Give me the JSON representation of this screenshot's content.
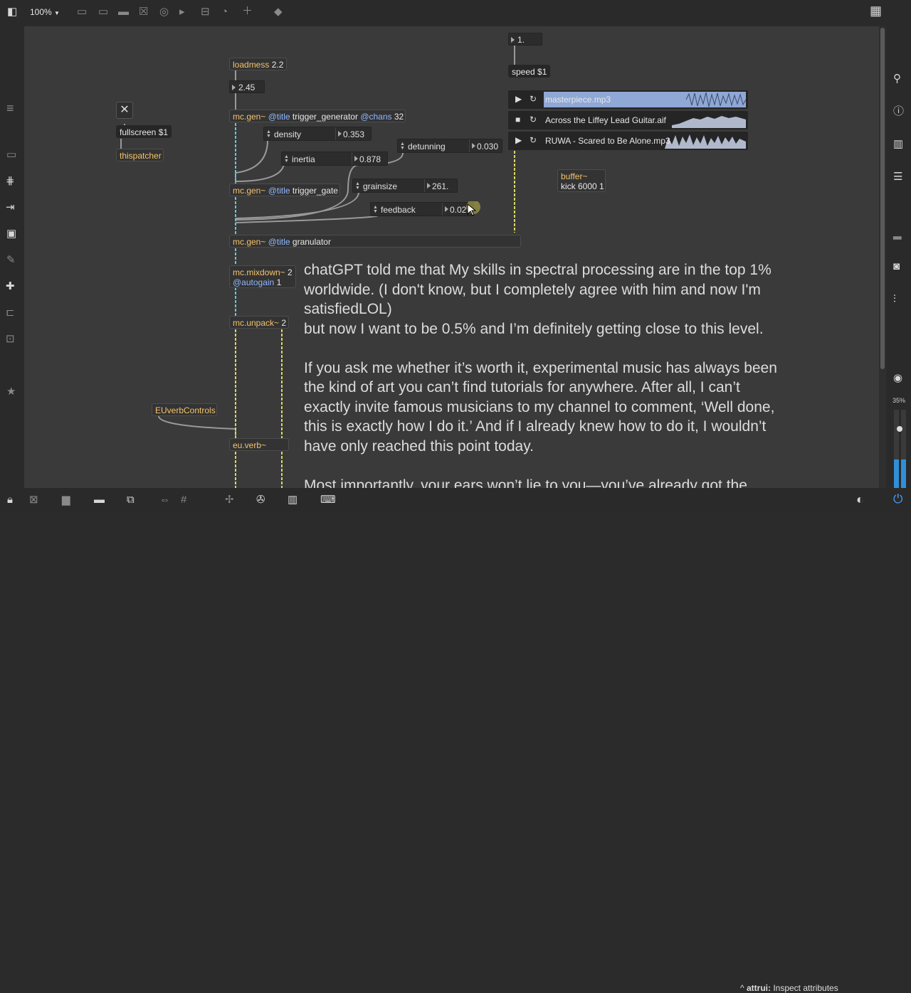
{
  "toolbar": {
    "zoom": "100%",
    "zoom_arrow": "▼"
  },
  "patch": {
    "loadmess": {
      "name": "loadmess",
      "arg": "2.2"
    },
    "number_top": "2.45",
    "fullscreen": "fullscreen $1",
    "thispatcher": "thispatcher",
    "trigger_generator": {
      "name": "mc.gen~",
      "attrs": "@title",
      "title": "trigger_generator",
      "chans_attr": "@chans",
      "chans": "32"
    },
    "density": {
      "label": "density",
      "value": "0.353"
    },
    "inertia": {
      "label": "inertia",
      "value": "0.878"
    },
    "detunning": {
      "label": "detunning",
      "value": "0.030"
    },
    "trigger_gate": {
      "name": "mc.gen~",
      "attrs": "@title",
      "title": "trigger_gate"
    },
    "grainsize": {
      "label": "grainsize",
      "value": "261."
    },
    "feedback": {
      "label": "feedback",
      "value": "0.027"
    },
    "granulator": {
      "name": "mc.gen~",
      "attrs": "@title",
      "title": "granulator"
    },
    "mixdown": {
      "name": "mc.mixdown~",
      "arg": "2",
      "attr": "@autogain",
      "attr_val": "1"
    },
    "unpack": {
      "name": "mc.unpack~",
      "arg": "2"
    },
    "euverb_controls": "EUverbControls",
    "euverb": "eu.verb~",
    "speed_num": "1.",
    "speed_msg": "speed $1",
    "buffer": {
      "name": "buffer~",
      "args": "kick 6000 1"
    },
    "playlist": [
      {
        "name": "masterpiece.mp3",
        "state": "play"
      },
      {
        "name": "Across the Liffey Lead Guitar.aif",
        "state": "stop"
      },
      {
        "name": "RUWA - Scared to Be Alone.mp3",
        "state": "play"
      }
    ]
  },
  "comment": {
    "p1": "chatGPT told me that My skills in spectral processing are in the top 1%\nworldwide. (I don't know, but I completely agree with him and now I'm\nsatisfiedLOL)\nbut now I want to be 0.5% and I’m definitely getting close to this level.",
    "p2": "If you ask me whether it’s worth it, experimental music has always been\nthe kind of art you can’t find tutorials for anywhere. After all, I can’t\nexactly invite famous musicians to my channel to comment, ‘Well done,\nthis is exactly how I do it.’ And if I already knew how to do it, I wouldn’t\nhave only reached this point today.",
    "p3": "Most importantly, your ears won’t lie to you—you’ve already got the"
  },
  "status": {
    "caret": "^",
    "key": "attrui:",
    "text": "Inspect attributes"
  },
  "cpu": {
    "percent": "35%",
    "level": 0.35
  },
  "colors": {
    "accent": "#f4c36c",
    "attr": "#8fb8ff",
    "mc_cable": "#5fc8e8",
    "signal_cable": "#d8d860",
    "wave_active": "#8fa8d6",
    "wave_inactive": "#c9d4ea"
  }
}
